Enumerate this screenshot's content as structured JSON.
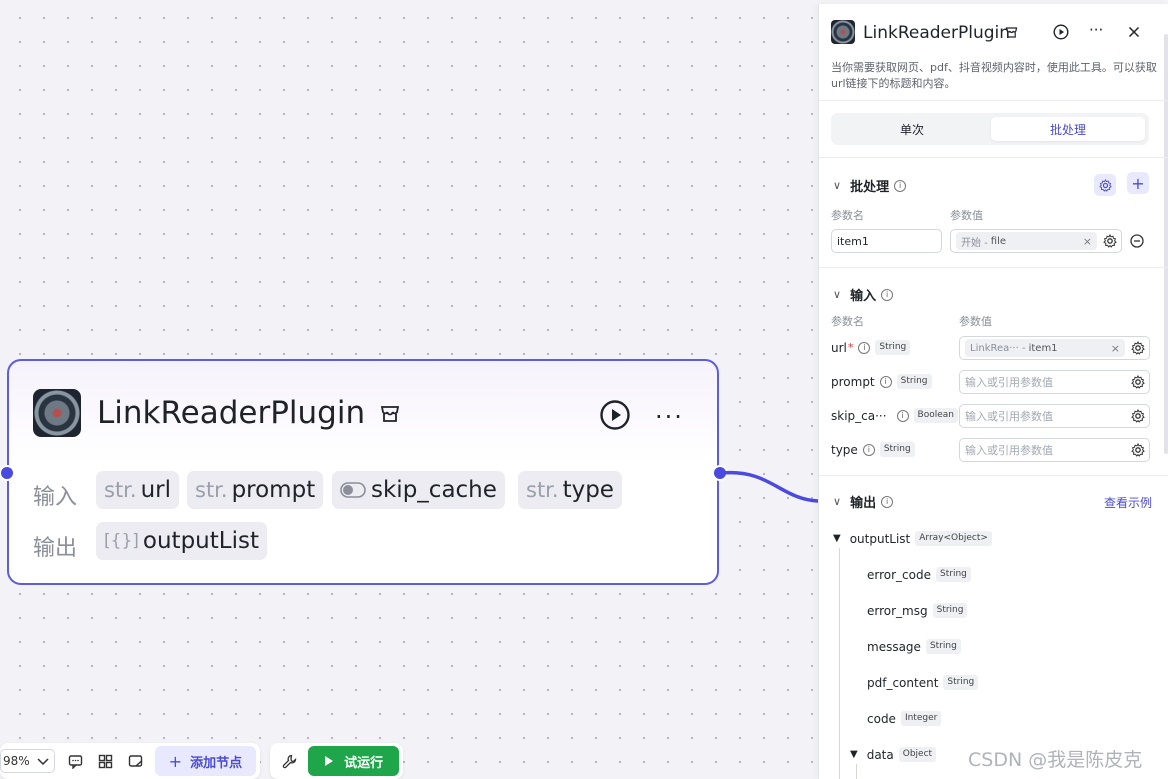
{
  "node": {
    "title": "LinkReaderPlugin",
    "input_label": "输入",
    "output_label": "输出",
    "inputs": [
      {
        "prefix": "str.",
        "name": "url"
      },
      {
        "prefix": "str.",
        "name": "prompt"
      },
      {
        "prefix": "toggle-icon",
        "name": "skip_cache"
      },
      {
        "prefix": "str.",
        "name": "type"
      }
    ],
    "outputs": [
      {
        "prefix": "[{}]",
        "name": "outputList"
      }
    ],
    "more": "···"
  },
  "toolbar": {
    "zoom": "98%",
    "add_node": "添加节点",
    "trial_run": "试运行"
  },
  "panel": {
    "title": "LinkReaderPlugin",
    "description": "当你需要获取网页、pdf、抖音视频内容时，使用此工具。可以获取url链接下的标题和内容。",
    "tabs": {
      "single": "单次",
      "batch": "批处理"
    },
    "batch": {
      "title": "批处理",
      "col_name": "参数名",
      "col_value": "参数值",
      "item_name": "item1",
      "ref_source": "开始 -",
      "ref_value": "file"
    },
    "input": {
      "title": "输入",
      "col_name": "参数名",
      "col_value": "参数值",
      "params": [
        {
          "name": "url",
          "required": true,
          "type": "String",
          "ref_source": "LinkRea··· -",
          "ref_value": "item1",
          "placeholder": ""
        },
        {
          "name": "prompt",
          "required": false,
          "type": "String",
          "placeholder": "输入或引用参数值"
        },
        {
          "name": "skip_ca···",
          "required": false,
          "type": "Boolean",
          "placeholder": "输入或引用参数值"
        },
        {
          "name": "type",
          "required": false,
          "type": "String",
          "placeholder": "输入或引用参数值"
        }
      ]
    },
    "output": {
      "title": "输出",
      "view_example": "查看示例",
      "root": {
        "name": "outputList",
        "type": "Array<Object>"
      },
      "fields": [
        {
          "name": "error_code",
          "type": "String"
        },
        {
          "name": "error_msg",
          "type": "String"
        },
        {
          "name": "message",
          "type": "String"
        },
        {
          "name": "pdf_content",
          "type": "String"
        },
        {
          "name": "code",
          "type": "Integer"
        }
      ],
      "data": {
        "name": "data",
        "type": "Object"
      }
    }
  },
  "watermark": "CSDN @我是陈皮克",
  "colors": {
    "accent": "#4b4bd6",
    "node_border": "#5c5ce0",
    "run_green": "#1fa64a"
  }
}
